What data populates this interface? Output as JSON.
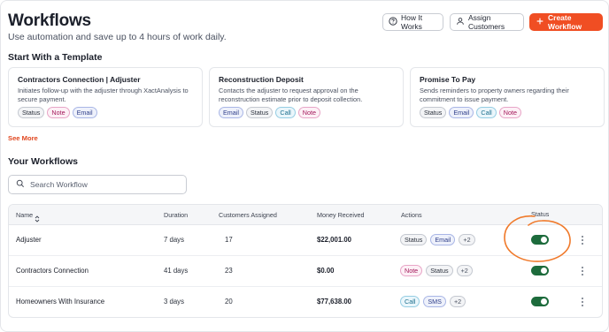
{
  "header": {
    "title": "Workflows",
    "subtitle": "Use automation and save up to 4 hours of work daily.",
    "how_it_works": "How It Works",
    "assign_customers": "Assign Customers",
    "create_workflow": "Create Workflow"
  },
  "templates": {
    "section_title": "Start With a Template",
    "see_more": "See More",
    "cards": [
      {
        "title": "Contractors Connection | Adjuster",
        "description": "Initiates follow-up with the adjuster through XactAnalysis to secure payment.",
        "tags": [
          "Status",
          "Note",
          "Email"
        ]
      },
      {
        "title": "Reconstruction Deposit",
        "description": "Contacts the adjuster to request approval on the reconstruction estimate prior to deposit collection.",
        "tags": [
          "Email",
          "Status",
          "Call",
          "Note"
        ]
      },
      {
        "title": "Promise To Pay",
        "description": "Sends reminders to property owners regarding their commitment to issue payment.",
        "tags": [
          "Status",
          "Email",
          "Call",
          "Note"
        ]
      }
    ]
  },
  "workflows": {
    "section_title": "Your Workflows",
    "search_placeholder": "Search Workflow",
    "columns": [
      "Name",
      "Duration",
      "Customers Assigned",
      "Money Received",
      "Actions",
      "Status"
    ],
    "rows": [
      {
        "name": "Adjuster",
        "duration": "7 days",
        "customers": "17",
        "money": "$22,001.00",
        "actions": [
          "Status",
          "Email",
          "+2"
        ],
        "status_on": true
      },
      {
        "name": "Contractors Connection",
        "duration": "41 days",
        "customers": "23",
        "money": "$0.00",
        "actions": [
          "Note",
          "Status",
          "+2"
        ],
        "status_on": true
      },
      {
        "name": "Homeowners With Insurance",
        "duration": "3 days",
        "customers": "20",
        "money": "$77,638.00",
        "actions": [
          "Call",
          "SMS",
          "+2"
        ],
        "status_on": true
      }
    ]
  },
  "colors": {
    "accent": "#f04e23",
    "toggle_on": "#1d6b3c",
    "annotation": "#f07a2b"
  },
  "icons": {
    "how_it_works": "question-circle-icon",
    "assign_customers": "user-icon",
    "create_workflow": "plus-icon",
    "search": "search-icon",
    "sort": "sort-icon",
    "row_menu": "kebab-menu-icon"
  }
}
